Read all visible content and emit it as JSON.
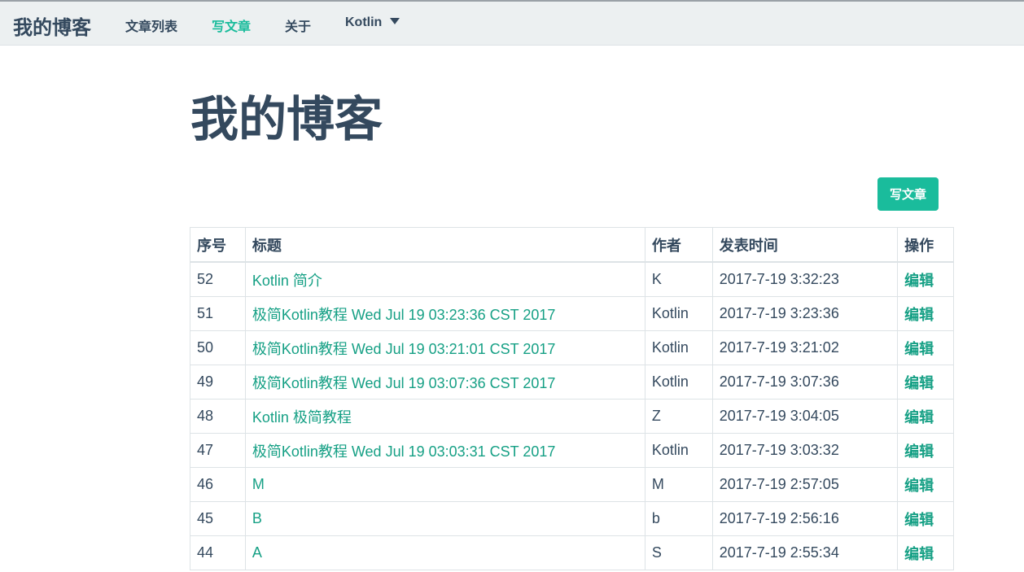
{
  "navbar": {
    "brand": "我的博客",
    "items": [
      {
        "label": "文章列表",
        "active": false
      },
      {
        "label": "写文章",
        "active": true
      },
      {
        "label": "关于",
        "active": false
      },
      {
        "label": "Kotlin",
        "active": false,
        "dropdown": true
      }
    ]
  },
  "page": {
    "title": "我的博客",
    "write_button": "写文章"
  },
  "table": {
    "headers": [
      "序号",
      "标题",
      "作者",
      "发表时间",
      "操作"
    ],
    "rows": [
      {
        "id": "52",
        "title": "Kotlin 简介",
        "author": "K",
        "time": "2017-7-19 3:32:23",
        "action": "编辑"
      },
      {
        "id": "51",
        "title": "极简Kotlin教程 Wed Jul 19 03:23:36 CST 2017",
        "author": "Kotlin",
        "time": "2017-7-19 3:23:36",
        "action": "编辑"
      },
      {
        "id": "50",
        "title": "极简Kotlin教程 Wed Jul 19 03:21:01 CST 2017",
        "author": "Kotlin",
        "time": "2017-7-19 3:21:02",
        "action": "编辑"
      },
      {
        "id": "49",
        "title": "极简Kotlin教程 Wed Jul 19 03:07:36 CST 2017",
        "author": "Kotlin",
        "time": "2017-7-19 3:07:36",
        "action": "编辑"
      },
      {
        "id": "48",
        "title": "Kotlin 极简教程",
        "author": "Z",
        "time": "2017-7-19 3:04:05",
        "action": "编辑"
      },
      {
        "id": "47",
        "title": "极简Kotlin教程 Wed Jul 19 03:03:31 CST 2017",
        "author": "Kotlin",
        "time": "2017-7-19 3:03:32",
        "action": "编辑"
      },
      {
        "id": "46",
        "title": "M",
        "author": "M",
        "time": "2017-7-19 2:57:05",
        "action": "编辑"
      },
      {
        "id": "45",
        "title": "B",
        "author": "b",
        "time": "2017-7-19 2:56:16",
        "action": "编辑"
      },
      {
        "id": "44",
        "title": "A",
        "author": "S",
        "time": "2017-7-19 2:55:34",
        "action": "编辑"
      }
    ]
  },
  "colors": {
    "accent": "#1abc9c",
    "link": "#16a085",
    "text": "#34495e",
    "navbar_bg": "#ecf0f1"
  },
  "icons": {
    "dropdown": "caret-down-icon"
  }
}
